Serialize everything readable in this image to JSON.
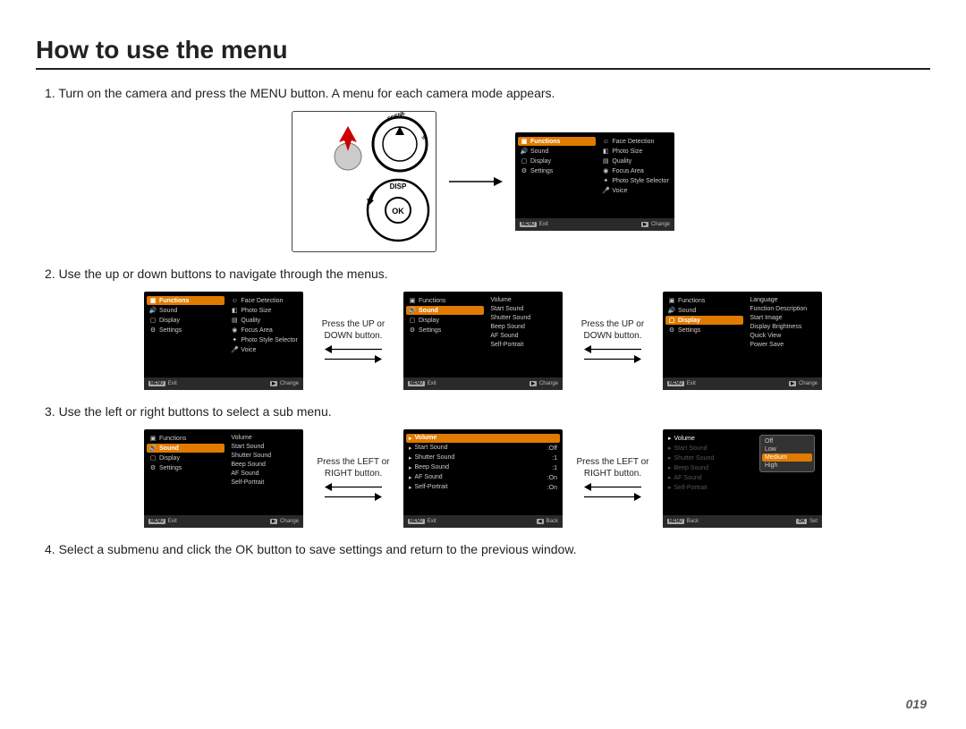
{
  "title": "How to use the menu",
  "page_number": "019",
  "steps": {
    "s1": "1. Turn on the camera and press the MENU button. A menu for each camera mode appears.",
    "s2": "2. Use the up or down buttons to navigate through the menus.",
    "s3": "3. Use the left or right buttons to select a sub menu.",
    "s4": "4. Select a submenu and click the OK button to save settings and return to the previous window."
  },
  "between": {
    "updown": "Press the UP or DOWN button.",
    "leftright": "Press the LEFT or RIGHT button."
  },
  "menu": {
    "left_items": {
      "functions": "Functions",
      "sound": "Sound",
      "display": "Display",
      "settings": "Settings"
    },
    "functions_right": [
      "Face Detection",
      "Photo Size",
      "Quality",
      "Focus Area",
      "Photo Style Selector",
      "Voice"
    ],
    "sound_right": [
      "Volume",
      "Start Sound",
      "Shutter Sound",
      "Beep Sound",
      "AF Sound",
      "Self-Portrait"
    ],
    "display_right": [
      "Language",
      "Function Description",
      "Start Image",
      "Display Brightness",
      "Quick View",
      "Power Save"
    ],
    "sound_values": {
      "volume": "Medium",
      "start": ":Off",
      "shutter": ":1",
      "beep": ":1",
      "af": ":On",
      "selfp": ":On"
    },
    "volume_options": [
      "Off",
      "Low",
      "Medium",
      "High"
    ]
  },
  "footer": {
    "exit_key": "MENU",
    "exit": "Exit",
    "change_key": "▶",
    "change": "Change",
    "back_key": "◀",
    "back": "Back",
    "set_key": "OK",
    "set": "Set"
  }
}
